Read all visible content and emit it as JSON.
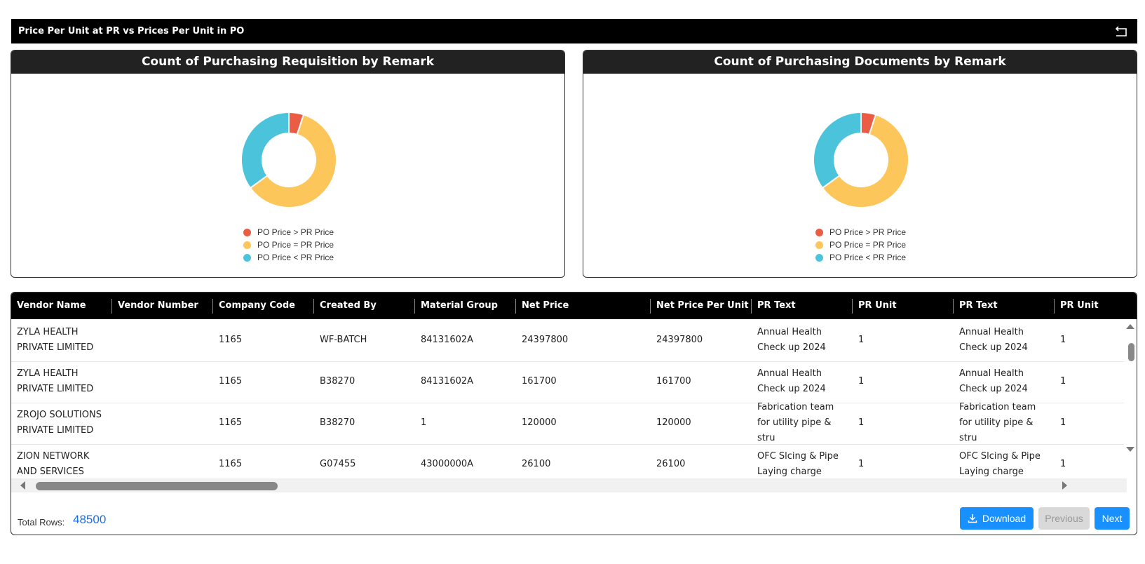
{
  "page": {
    "title": "Price Per Unit at PR vs Prices Per Unit in PO"
  },
  "charts": {
    "left_title": "Count of Purchasing Requisition by Remark",
    "right_title": "Count of Purchasing Documents by Remark",
    "legend": [
      {
        "label": "PO Price > PR Price",
        "color": "#ea5c43"
      },
      {
        "label": "PO Price = PR Price",
        "color": "#fdc65b"
      },
      {
        "label": "PO Price < PR Price",
        "color": "#4bc3da"
      }
    ]
  },
  "chart_data": [
    {
      "type": "pie",
      "title": "Count of Purchasing Requisition by Remark",
      "donut": true,
      "categories": [
        "PO Price > PR Price",
        "PO Price = PR Price",
        "PO Price < PR Price"
      ],
      "values": [
        5,
        60,
        35
      ],
      "colors": [
        "#ea5c43",
        "#fdc65b",
        "#4bc3da"
      ],
      "legend": "bottom"
    },
    {
      "type": "pie",
      "title": "Count of Purchasing Documents by Remark",
      "donut": true,
      "categories": [
        "PO Price > PR Price",
        "PO Price = PR Price",
        "PO Price < PR Price"
      ],
      "values": [
        5,
        60,
        35
      ],
      "colors": [
        "#ea5c43",
        "#fdc65b",
        "#4bc3da"
      ],
      "legend": "bottom"
    }
  ],
  "table": {
    "columns": [
      "Vendor Name",
      "Vendor Number",
      "Company Code",
      "Created By",
      "Material Group",
      "Net Price",
      "Net Price Per Unit",
      "PR Text",
      "PR Unit",
      "PR Text",
      "PR Unit"
    ],
    "rows": [
      [
        "ZYLA HEALTH PRIVATE LIMITED",
        "",
        "1165",
        "WF-BATCH",
        "84131602A",
        "24397800",
        "24397800",
        "Annual Health Check up 2024",
        "1",
        "Annual Health Check up 2024",
        "1"
      ],
      [
        "ZYLA HEALTH PRIVATE LIMITED",
        "",
        "1165",
        "B38270",
        "84131602A",
        "161700",
        "161700",
        "Annual Health Check up 2024",
        "1",
        "Annual Health Check up 2024",
        "1"
      ],
      [
        "ZROJO SOLUTIONS PRIVATE LIMITED",
        "",
        "1165",
        "B38270",
        "1",
        "120000",
        "120000",
        "Fabrication team for utility pipe & stru",
        "1",
        "Fabrication team for utility pipe & stru",
        "1"
      ],
      [
        "ZION NETWORK AND SERVICES",
        "",
        "1165",
        "G07455",
        "43000000A",
        "26100",
        "26100",
        "OFC Slcing & Pipe Laying charge",
        "1",
        "OFC Slcing & Pipe Laying charge",
        "1"
      ]
    ]
  },
  "footer": {
    "total_label": "Total Rows:",
    "total_value": "48500",
    "download_label": "Download",
    "previous_label": "Previous",
    "next_label": "Next"
  }
}
